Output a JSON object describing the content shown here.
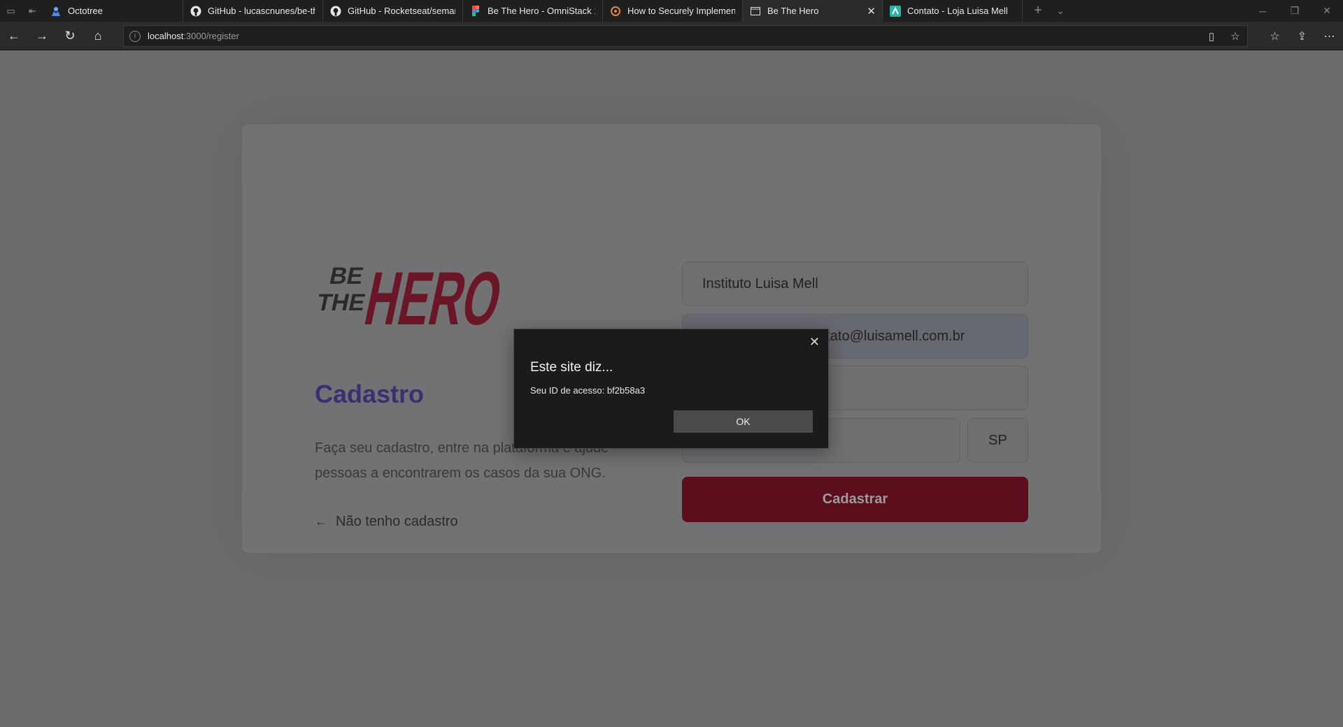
{
  "browser": {
    "tabs": [
      {
        "label": "Octotree",
        "icon": "octotree-icon",
        "active": false
      },
      {
        "label": "GitHub - lucascnunes/be-th",
        "icon": "github-icon",
        "active": false
      },
      {
        "label": "GitHub - Rocketseat/seman",
        "icon": "github-icon",
        "active": false
      },
      {
        "label": "Be The Hero - OmniStack 1",
        "icon": "figma-icon",
        "active": false
      },
      {
        "label": "How to Securely Implement",
        "icon": "blog-icon",
        "active": false
      },
      {
        "label": "Be The Hero",
        "icon": "page-icon",
        "active": true
      },
      {
        "label": "Contato - Loja Luisa Mell",
        "icon": "store-icon",
        "active": false
      }
    ],
    "url_host": "localhost",
    "url_path": ":3000/register"
  },
  "page": {
    "logo_line1": "BE",
    "logo_line2": "THE",
    "logo_word": "HERO",
    "title": "Cadastro",
    "description": "Faça seu cadastro, entre na plataforma e ajude pessoas a encontrarem os casos da sua ONG.",
    "back_link": "Não tenho cadastro",
    "form": {
      "name_value": "Instituto Luisa Mell",
      "email_value": "contato@luisamell.com.br",
      "whatsapp_value": "",
      "city_value": "",
      "uf_value": "SP",
      "submit_label": "Cadastrar"
    }
  },
  "dialog": {
    "title": "Este site diz...",
    "message": "Seu ID de acesso: bf2b58a3",
    "ok_label": "OK"
  },
  "colors": {
    "brand_red": "#e02041",
    "brand_purple": "#41414d",
    "overlay_dim": "#6b6b6e"
  }
}
